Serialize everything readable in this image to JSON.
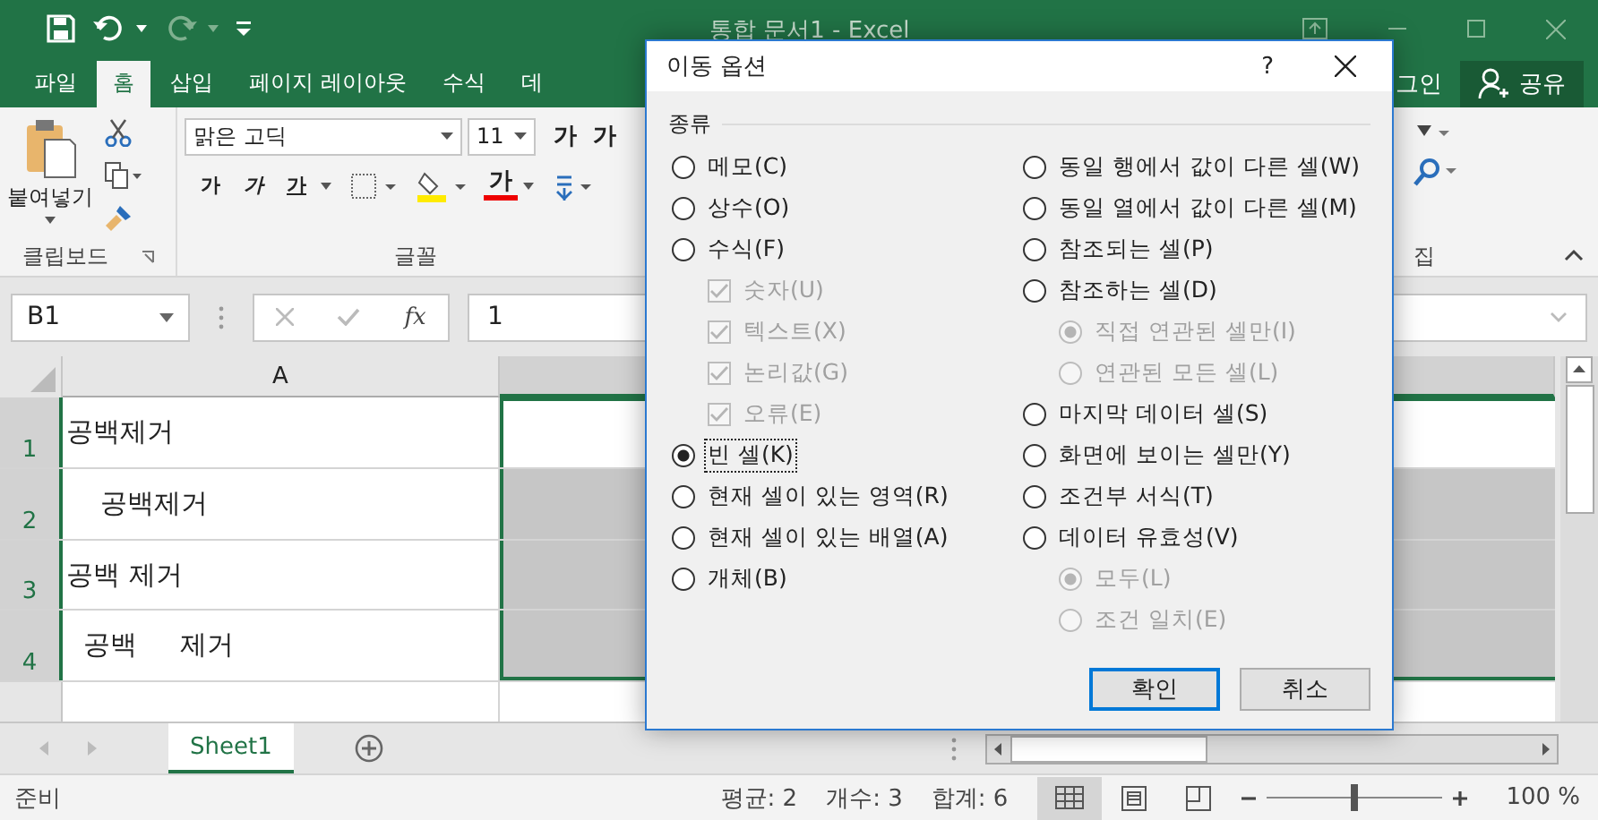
{
  "window": {
    "title": "통합 문서1 - Excel"
  },
  "ribbon_tabs": [
    {
      "label": "파일",
      "selected": false
    },
    {
      "label": "홈",
      "selected": true
    },
    {
      "label": "삽입",
      "selected": false
    },
    {
      "label": "페이지 레이아웃",
      "selected": false
    },
    {
      "label": "수식",
      "selected": false
    },
    {
      "label": "데",
      "selected": false
    }
  ],
  "signin": "그인",
  "share": "공유",
  "ribbon": {
    "paste": "붙여넣기",
    "font_name": "맑은 고딕",
    "font_size": "11",
    "grow": "가",
    "shrink": "가",
    "bold": "가",
    "italic": "가",
    "underline": "가",
    "font_color": "가",
    "groups": [
      "클립보드",
      "글꼴",
      "집"
    ]
  },
  "formula_bar": {
    "name_box": "B1",
    "function_label": "fx",
    "value": "1"
  },
  "columns": [
    "A"
  ],
  "rows": [
    {
      "number": "1",
      "text": "공백제거",
      "selected": true,
      "active": true
    },
    {
      "number": "2",
      "text": "    공백제거",
      "selected": true,
      "active": false
    },
    {
      "number": "3",
      "text": "공백 제거",
      "selected": true,
      "active": false
    },
    {
      "number": "4",
      "text": "  공백     제거",
      "selected": true,
      "active": false
    }
  ],
  "sheet_tabs": [
    {
      "label": "Sheet1",
      "selected": true
    }
  ],
  "status_bar": {
    "mode": "준비",
    "average": "평균: 2",
    "count": "개수: 3",
    "sum": "합계: 6",
    "zoom": "100 %",
    "zoom_slider": {
      "level": 0.5
    }
  },
  "dialog": {
    "title": "이동 옵션",
    "help": "?",
    "group": "종류",
    "left": [
      {
        "kind": "radio",
        "label": "메모(C)",
        "selected": false,
        "disabled": false
      },
      {
        "kind": "radio",
        "label": "상수(O)",
        "selected": false,
        "disabled": false
      },
      {
        "kind": "radio",
        "label": "수식(F)",
        "selected": false,
        "disabled": false,
        "children": [
          {
            "kind": "checkbox",
            "label": "숫자(U)",
            "checked": true,
            "disabled": true
          },
          {
            "kind": "checkbox",
            "label": "텍스트(X)",
            "checked": true,
            "disabled": true
          },
          {
            "kind": "checkbox",
            "label": "논리값(G)",
            "checked": true,
            "disabled": true
          },
          {
            "kind": "checkbox",
            "label": "오류(E)",
            "checked": true,
            "disabled": true
          }
        ]
      },
      {
        "kind": "radio",
        "label": "빈 셀(K)",
        "selected": true,
        "disabled": false
      },
      {
        "kind": "radio",
        "label": "현재 셀이 있는 영역(R)",
        "selected": false,
        "disabled": false
      },
      {
        "kind": "radio",
        "label": "현재 셀이 있는 배열(A)",
        "selected": false,
        "disabled": false
      },
      {
        "kind": "radio",
        "label": "개체(B)",
        "selected": false,
        "disabled": false
      }
    ],
    "right": [
      {
        "kind": "radio",
        "label": "동일 행에서 값이 다른 셀(W)",
        "selected": false,
        "disabled": false
      },
      {
        "kind": "radio",
        "label": "동일 열에서 값이 다른 셀(M)",
        "selected": false,
        "disabled": false
      },
      {
        "kind": "radio",
        "label": "참조되는 셀(P)",
        "selected": false,
        "disabled": false
      },
      {
        "kind": "radio",
        "label": "참조하는 셀(D)",
        "selected": false,
        "disabled": false,
        "children": [
          {
            "kind": "radio",
            "label": "직접 연관된 셀만(I)",
            "selected": true,
            "disabled": true
          },
          {
            "kind": "radio",
            "label": "연관된 모든 셀(L)",
            "selected": false,
            "disabled": true
          }
        ]
      },
      {
        "kind": "radio",
        "label": "마지막 데이터 셀(S)",
        "selected": false,
        "disabled": false
      },
      {
        "kind": "radio",
        "label": "화면에 보이는 셀만(Y)",
        "selected": false,
        "disabled": false
      },
      {
        "kind": "radio",
        "label": "조건부 서식(T)",
        "selected": false,
        "disabled": false
      },
      {
        "kind": "radio",
        "label": "데이터 유효성(V)",
        "selected": false,
        "disabled": false,
        "children": [
          {
            "kind": "radio",
            "label": "모두(L)",
            "selected": true,
            "disabled": true
          },
          {
            "kind": "radio",
            "label": "조건 일치(E)",
            "selected": false,
            "disabled": true
          }
        ]
      }
    ],
    "buttons": [
      {
        "label": "확인",
        "default": true
      },
      {
        "label": "취소",
        "default": false
      }
    ]
  }
}
